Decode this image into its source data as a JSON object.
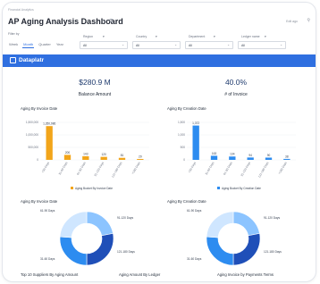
{
  "breadcrumb": "Financial Analytics",
  "title": "AP Aging Analysis Dashboard",
  "edited": "Edit ago",
  "filter_label": "Filter by",
  "periods": [
    {
      "label": "Week",
      "active": false
    },
    {
      "label": "Month",
      "active": true
    },
    {
      "label": "Quarter",
      "active": false
    },
    {
      "label": "Year",
      "active": false
    }
  ],
  "filters": [
    {
      "label": "Region",
      "value": "All"
    },
    {
      "label": "Country",
      "value": "All"
    },
    {
      "label": "Department",
      "value": "All"
    },
    {
      "label": "Ledger name",
      "value": "All"
    }
  ],
  "brand": "Dataplatr",
  "kpis": [
    {
      "value": "$280.9 M",
      "label": "Balance Amount"
    },
    {
      "value": "40.0%",
      "label": "# of Invoice"
    }
  ],
  "chart_titles": {
    "bar_invoice": "Aging By Invoice Date",
    "bar_creation": "Aging By Creation Date",
    "donut_invoice": "Aging By Invoice Date",
    "donut_creation": "Aging By Creation Date"
  },
  "bottom_titles": [
    "Top 10 Suppliers By Aging Amount",
    "Aging Amount By Ledger",
    "Aging Invoice by Payments Terms"
  ],
  "colors": {
    "accent": "#2f6fe0",
    "bar_orange": "#f2a51a",
    "bar_blue": "#2d8cf0",
    "donut_dark": "#1f4fb8",
    "donut_mid": "#2d8cf0",
    "donut_light": "#8cc4ff",
    "donut_pale": "#cfe6ff"
  },
  "chart_data": [
    {
      "type": "bar",
      "title": "Aging By Invoice Date",
      "categories": [
        "<30 Days",
        "31-60 Days",
        "61-90 Days",
        "91-120 Days",
        "121-180 Days",
        ">180 Days"
      ],
      "yticks": [
        "1,500,000",
        "1,000,000",
        "500,000",
        "0"
      ],
      "ylim": [
        0,
        1500000
      ],
      "values": [
        1350000,
        200000,
        143000,
        120000,
        81000,
        29000
      ],
      "value_labels": [
        "1,350,986",
        "200",
        "143",
        "120",
        "81",
        "29"
      ],
      "legend": "Aging Bucket By Invoice Date",
      "color": "#f2a51a"
    },
    {
      "type": "bar",
      "title": "Aging By Creation Date",
      "categories": [
        "<30 Days",
        "31-60 Days",
        "61-90 Days",
        "91-120 Days",
        "121-180 Days",
        ">180 Days"
      ],
      "yticks": [
        "1,500",
        "1,000",
        "500",
        "0"
      ],
      "ylim": [
        0,
        1500
      ],
      "values": [
        1372,
        163,
        134,
        94,
        90,
        38
      ],
      "value_labels": [
        "1,372",
        "163",
        "134",
        "94",
        "90",
        "38"
      ],
      "legend": "Aging Bucket By Creation Date",
      "color": "#2d8cf0"
    },
    {
      "type": "pie",
      "title": "Aging By Invoice Date",
      "labels": [
        "61-90 Days",
        "91-120 Days",
        "121-180 Days",
        "31-60 Days"
      ],
      "values": [
        22,
        28,
        26,
        24
      ]
    },
    {
      "type": "pie",
      "title": "Aging By Creation Date",
      "labels": [
        "61-90 Days",
        "91-120 Days",
        "121-180 Days",
        "31-60 Days"
      ],
      "values": [
        22,
        28,
        26,
        24
      ]
    }
  ]
}
